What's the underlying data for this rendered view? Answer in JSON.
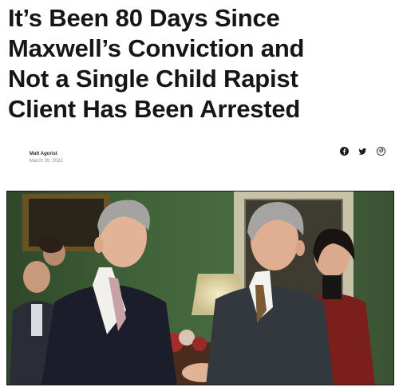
{
  "article": {
    "headline_lines": [
      "It’s Been 80 Days Since",
      "Maxwell’s Conviction and",
      "Not a Single Child Rapist",
      "Client Has Been Arrested"
    ],
    "author": "Matt Agorist",
    "date": "March 20, 2022"
  },
  "share": {
    "icons": [
      "facebook-icon",
      "twitter-icon",
      "pinterest-icon"
    ]
  },
  "colors": {
    "headline": "#161616",
    "photo_wall": "#3c5b33",
    "date": "#8a8a8a"
  }
}
